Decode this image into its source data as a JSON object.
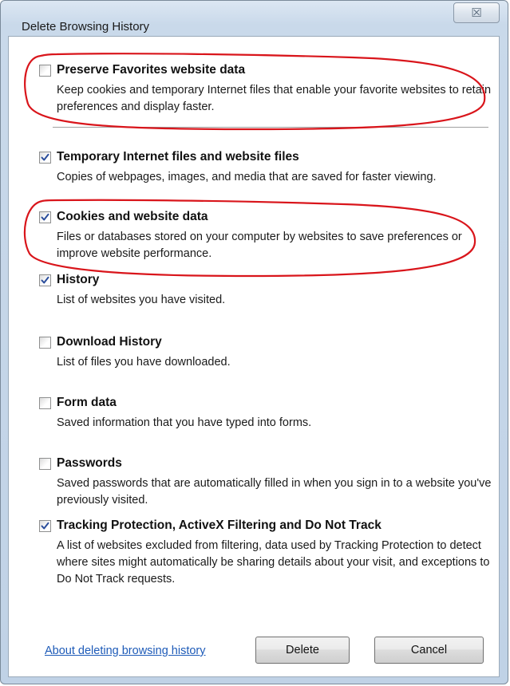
{
  "window": {
    "title": "Delete Browsing History",
    "close_glyph": "☒",
    "close_icon": "close-icon"
  },
  "options": [
    {
      "id": "preserve-favorites",
      "label": "Preserve Favorites website data",
      "description": "Keep cookies and temporary Internet files that enable your favorite websites to retain preferences and display faster.",
      "checked": false
    },
    {
      "id": "temporary-files",
      "label": "Temporary Internet files and website files",
      "description": "Copies of webpages, images, and media that are saved for faster viewing.",
      "checked": true
    },
    {
      "id": "cookies",
      "label": "Cookies and website data",
      "description": "Files or databases stored on your computer by websites to save preferences or improve website performance.",
      "checked": true
    },
    {
      "id": "history",
      "label": "History",
      "description": "List of websites you have visited.",
      "checked": true
    },
    {
      "id": "download-history",
      "label": "Download History",
      "description": "List of files you have downloaded.",
      "checked": false
    },
    {
      "id": "form-data",
      "label": "Form data",
      "description": "Saved information that you have typed into forms.",
      "checked": false
    },
    {
      "id": "passwords",
      "label": "Passwords",
      "description": "Saved passwords that are automatically filled in when you sign in to a website you've previously visited.",
      "checked": false
    },
    {
      "id": "tracking-protection",
      "label": "Tracking Protection, ActiveX Filtering and Do Not Track",
      "description": "A list of websites excluded from filtering, data used by Tracking Protection to detect where sites might automatically be sharing details about your visit, and exceptions to Do Not Track requests.",
      "checked": true
    }
  ],
  "footer": {
    "link_text": "About deleting browsing history",
    "delete_label": "Delete",
    "cancel_label": "Cancel"
  },
  "colors": {
    "annotation": "#d9151b",
    "link": "#1e5bb8",
    "checkmark": "#2a4d9b"
  }
}
